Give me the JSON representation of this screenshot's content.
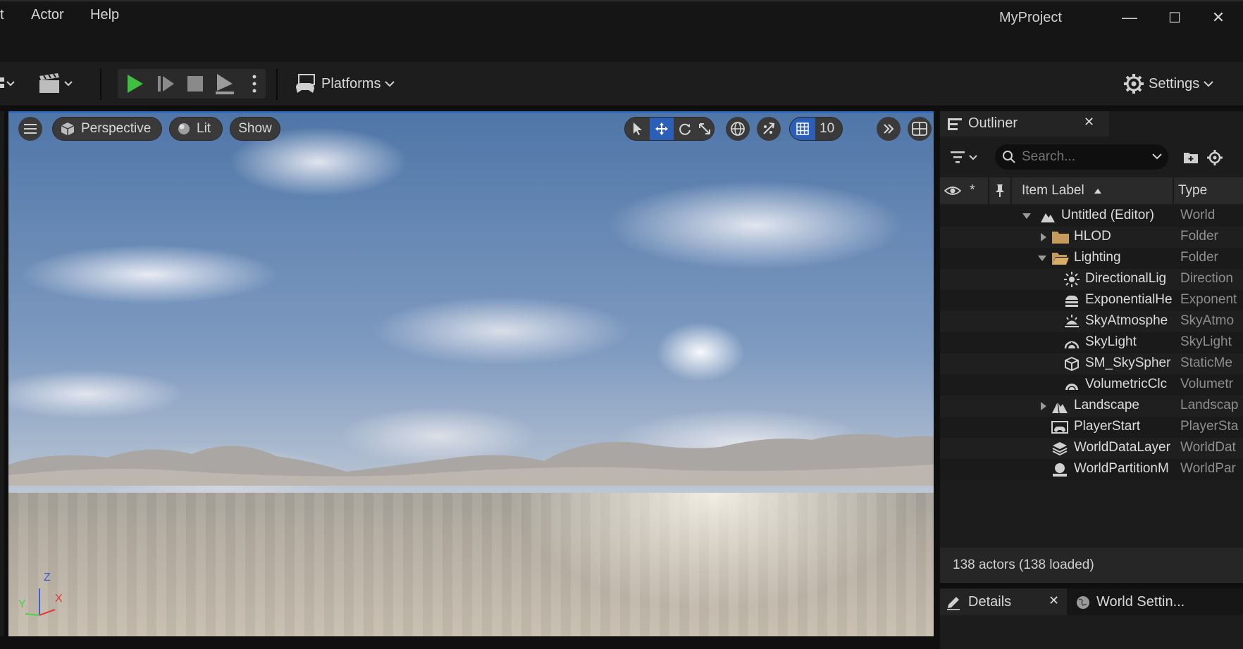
{
  "menu": {
    "partial": "t",
    "actor": "Actor",
    "help": "Help"
  },
  "window": {
    "title": "MyProject",
    "minimize": "—",
    "maximize": "☐",
    "close": "✕"
  },
  "toolbar": {
    "platforms_label": "Platforms",
    "settings_label": "Settings"
  },
  "viewport": {
    "perspective_label": "Perspective",
    "lit_label": "Lit",
    "show_label": "Show",
    "grid_snap_value": "10",
    "axis_z": "Z",
    "axis_x": "X",
    "axis_y": "Y"
  },
  "outliner": {
    "title": "Outliner",
    "search_placeholder": "Search...",
    "col_label": "Item Label",
    "col_type": "Type",
    "rows": [
      {
        "label": "Untitled (Editor)",
        "type": "World",
        "icon": "world-icon"
      },
      {
        "label": "HLOD",
        "type": "Folder",
        "icon": "folder-icon"
      },
      {
        "label": "Lighting",
        "type": "Folder",
        "icon": "folder-open-icon"
      },
      {
        "label": "DirectionalLig",
        "type": "Direction",
        "icon": "directional-light-icon"
      },
      {
        "label": "ExponentialHe",
        "type": "Exponent",
        "icon": "fog-icon"
      },
      {
        "label": "SkyAtmosphe",
        "type": "SkyAtmo",
        "icon": "sky-atmosphere-icon"
      },
      {
        "label": "SkyLight",
        "type": "SkyLight",
        "icon": "skylight-icon"
      },
      {
        "label": "SM_SkySpher",
        "type": "StaticMe",
        "icon": "static-mesh-icon"
      },
      {
        "label": "VolumetricClc",
        "type": "Volumetr",
        "icon": "cloud-icon"
      },
      {
        "label": "Landscape",
        "type": "Landscap",
        "icon": "landscape-icon"
      },
      {
        "label": "PlayerStart",
        "type": "PlayerSta",
        "icon": "player-start-icon"
      },
      {
        "label": "WorldDataLayer",
        "type": "WorldDat",
        "icon": "layers-icon"
      },
      {
        "label": "WorldPartitionM",
        "type": "WorldPar",
        "icon": "world-partition-icon"
      }
    ],
    "status": "138 actors (138 loaded)"
  },
  "details": {
    "tab_label": "Details",
    "world_settings_label": "World Settin..."
  }
}
